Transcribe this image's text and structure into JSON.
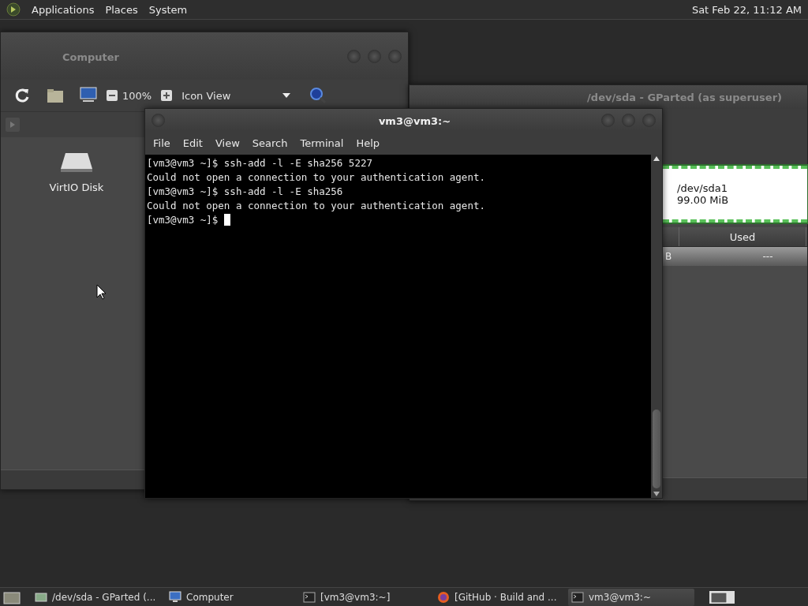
{
  "top_panel": {
    "menus": [
      {
        "label": "Applications"
      },
      {
        "label": "Places"
      },
      {
        "label": "System"
      }
    ],
    "clock": "Sat Feb 22, 11:12 AM"
  },
  "file_manager": {
    "title": "Computer",
    "active": false,
    "zoom": "100%",
    "view": "Icon View",
    "items": [
      {
        "label": "VirtIO Disk"
      }
    ]
  },
  "gparted": {
    "title": "/dev/sda - GParted (as superuser)",
    "active": false,
    "partition": {
      "name": "/dev/sda1",
      "size": "99.00 MiB"
    },
    "columns": [
      {
        "label": "Used"
      }
    ],
    "rows": [
      {
        "cells": [
          "B",
          "---"
        ]
      }
    ]
  },
  "terminal": {
    "title": "vm3@vm3:~",
    "active": true,
    "menus": [
      {
        "label": "File"
      },
      {
        "label": "Edit"
      },
      {
        "label": "View"
      },
      {
        "label": "Search"
      },
      {
        "label": "Terminal"
      },
      {
        "label": "Help"
      }
    ],
    "lines": [
      {
        "text": "[vm3@vm3 ~]$ ssh-add -l -E sha256 5227",
        "cursor": false
      },
      {
        "text": "Could not open a connection to your authentication agent.",
        "cursor": false
      },
      {
        "text": "[vm3@vm3 ~]$ ssh-add -l -E sha256",
        "cursor": false
      },
      {
        "text": "Could not open a connection to your authentication agent.",
        "cursor": false
      },
      {
        "text": "[vm3@vm3 ~]$ ",
        "cursor": true
      }
    ]
  },
  "taskbar": {
    "items": [
      {
        "label": "/dev/sda - GParted (...",
        "kind": "disk",
        "selected": false
      },
      {
        "label": "Computer",
        "kind": "monitor",
        "selected": false
      },
      {
        "label": "[vm3@vm3:~]",
        "kind": "terminal",
        "selected": false
      },
      {
        "label": "[GitHub · Build and ...",
        "kind": "browser",
        "selected": false
      },
      {
        "label": "vm3@vm3:~",
        "kind": "terminal",
        "selected": true
      }
    ]
  }
}
